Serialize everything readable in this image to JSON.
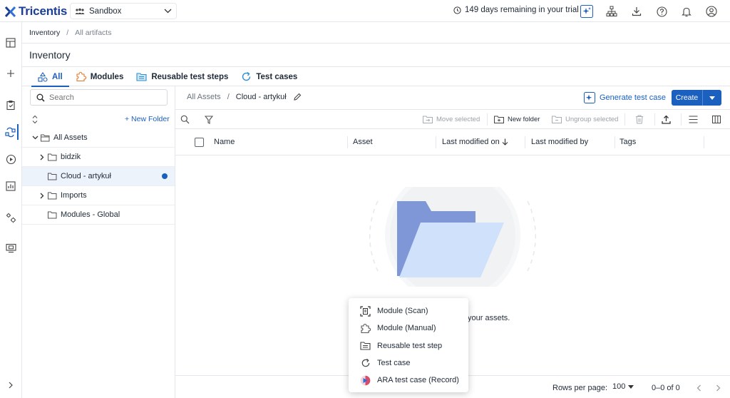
{
  "topbar": {
    "brand": "Tricentis",
    "workspace": "Sandbox",
    "trial_text": "149 days remaining in your trial"
  },
  "breadcrumb": {
    "root": "Inventory",
    "separator": "/",
    "current": "All artifacts"
  },
  "page_title": "Inventory",
  "tabs": [
    {
      "label": "All",
      "icon": "shapes-icon"
    },
    {
      "label": "Modules",
      "icon": "puzzle-icon"
    },
    {
      "label": "Reusable test steps",
      "icon": "steps-folder-icon"
    },
    {
      "label": "Test cases",
      "icon": "refresh-icon"
    }
  ],
  "tree": {
    "search_placeholder": "Search",
    "new_folder": "+ New Folder",
    "nodes": [
      {
        "label": "All Assets"
      },
      {
        "label": "bidzik"
      },
      {
        "label": "Cloud - artykuł"
      },
      {
        "label": "Imports"
      },
      {
        "label": "Modules - Global"
      }
    ]
  },
  "content": {
    "crumb_root": "All Assets",
    "crumb_sep": "/",
    "crumb_current": "Cloud - artykuł",
    "generate_label": "Generate test case",
    "create_label": "Create",
    "toolbar": {
      "move_selected": "Move selected",
      "new_folder": "New folder",
      "ungroup_selected": "Ungroup selected"
    },
    "columns": {
      "name": "Name",
      "asset": "Asset",
      "last_modified_on": "Last modified on",
      "last_modified_by": "Last modified by",
      "tags": "Tags"
    },
    "empty_text": "your assets.",
    "footer": {
      "rows_per_page_label": "Rows per page:",
      "rows_per_page_value": "100",
      "range": "0–0 of 0"
    }
  },
  "create_menu": [
    {
      "label": "Module (Scan)",
      "icon": "scan-icon"
    },
    {
      "label": "Module (Manual)",
      "icon": "puzzle-icon"
    },
    {
      "label": "Reusable test step",
      "icon": "steps-folder-icon"
    },
    {
      "label": "Test case",
      "icon": "refresh-icon"
    },
    {
      "label": "ARA test case (Record)",
      "icon": "ara-record-icon"
    }
  ],
  "colors": {
    "accent": "#1b5fbf",
    "brand": "#1b3f94",
    "selected_row": "#edf3fb",
    "modules_orange": "#e8772e",
    "steps_blue": "#2f8fcf"
  }
}
